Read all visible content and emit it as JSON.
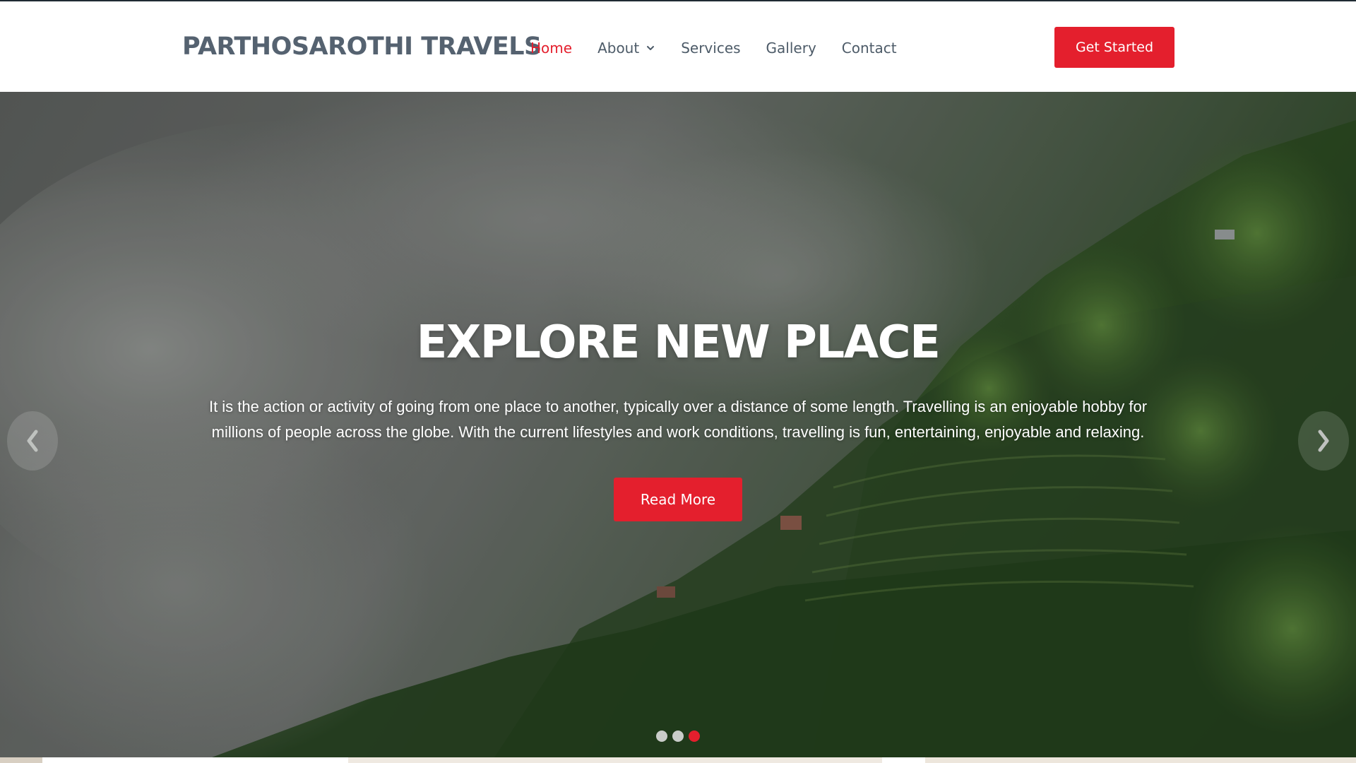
{
  "header": {
    "brand": "PARTHOSAROTHI TRAVELS",
    "nav": [
      "Home",
      "About",
      "Services",
      "Gallery",
      "Contact"
    ],
    "active_nav": "Home",
    "cta_label": "Get Started"
  },
  "hero": {
    "title": "EXPLORE NEW PLACE",
    "description": "It is the action or activity of going from one place to another, typically over a distance of some length. Travelling is an enjoyable hobby for millions of people across the globe. With the current lifestyles and work conditions, travelling is fun, entertaining, enjoyable and relaxing.",
    "button_label": "Read More",
    "slide_count": 3,
    "active_slide": 3
  },
  "icons": {
    "about_dropdown": "chevron-down-icon",
    "prev": "chevron-left-icon",
    "next": "chevron-right-icon"
  },
  "colors": {
    "accent": "#e41f2d",
    "brand_text": "#556270",
    "nav_text": "#4d5b68"
  }
}
